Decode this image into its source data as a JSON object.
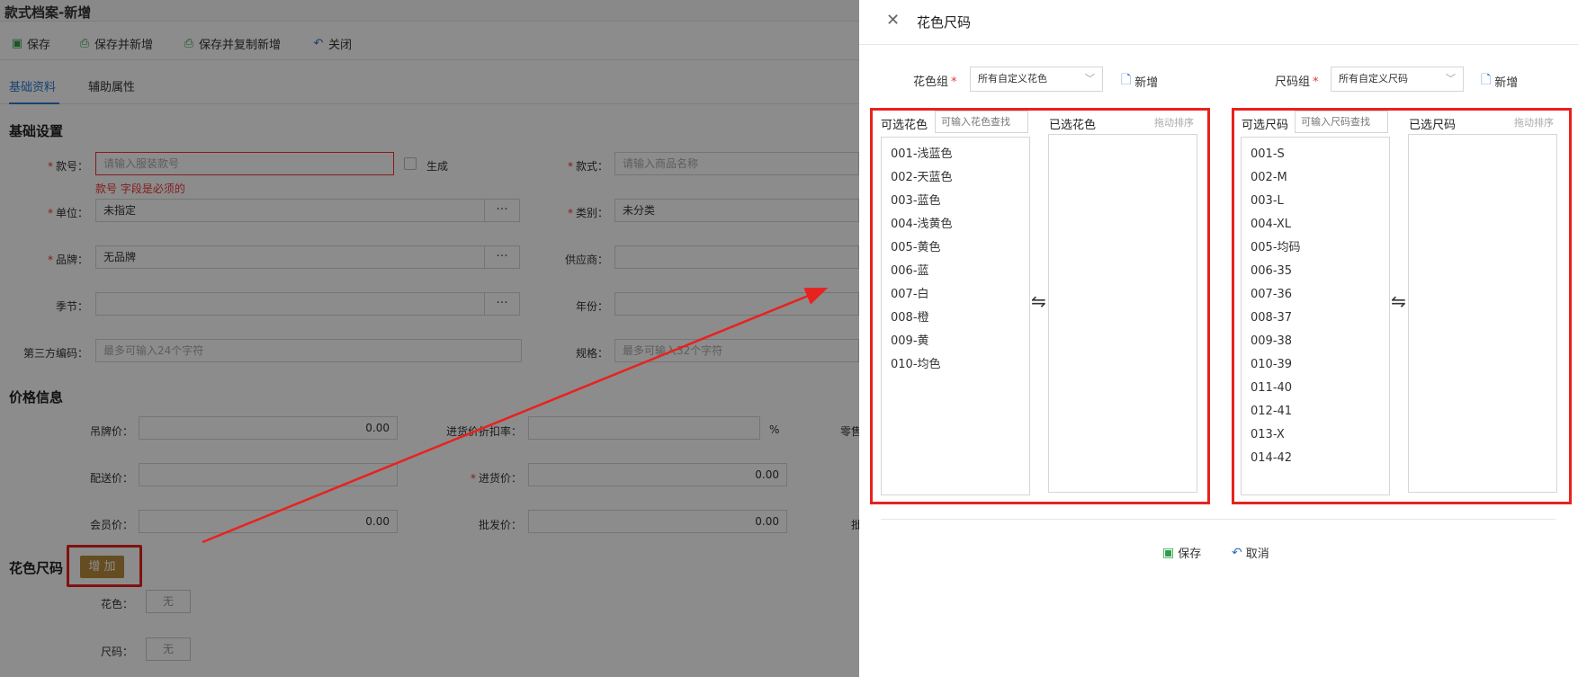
{
  "page": {
    "title": "款式档案-新增",
    "toolbar": {
      "save": "保存",
      "save_new": "保存并新增",
      "save_copy_new": "保存并复制新增",
      "close": "关闭"
    },
    "tabs": [
      "基础资料",
      "辅助属性"
    ],
    "basic_section": "基础设置",
    "fields": {
      "style_no_label": "款号",
      "style_no_placeholder": "请输入服装款号",
      "generate_label": "生成",
      "style_no_error": "款号 字段是必须的",
      "style_label": "款式",
      "style_placeholder": "请输入商品名称",
      "unit_label": "单位",
      "unit_value": "未指定",
      "category_label": "类别",
      "category_value": "未分类",
      "brand_label": "品牌",
      "brand_value": "无品牌",
      "supplier_label": "供应商",
      "season_label": "季节",
      "year_label": "年份",
      "third_code_label": "第三方编码",
      "third_code_placeholder": "最多可输入24个字符",
      "spec_label": "规格",
      "spec_placeholder": "最多可输入32个字符",
      "dots": "···"
    },
    "price_section": "价格信息",
    "price": {
      "tag_price_label": "吊牌价",
      "tag_price_value": "0.00",
      "discount_label": "进货价折扣率",
      "percent": "%",
      "retail_label_partial": "零售",
      "delivery_label": "配送价",
      "purchase_label": "进货价",
      "purchase_value": "0.00",
      "member_label": "会员价",
      "member_value": "0.00",
      "wholesale_label": "批发价",
      "wholesale_value": "0.00",
      "extra_label_partial": "批"
    },
    "color_size_section": "花色尺码",
    "add_button": "增 加",
    "color_label": "花色",
    "size_label": "尺码",
    "none_text": "无"
  },
  "dialog": {
    "title": "花色尺码",
    "color_group_label": "花色组",
    "color_group_value": "所有自定义花色",
    "size_group_label": "尺码组",
    "size_group_value": "所有自定义尺码",
    "new_label": "新增",
    "color_panel": {
      "available_label": "可选花色",
      "search_placeholder": "可输入花色查找",
      "selected_label": "已选花色",
      "drag_hint": "拖动排序",
      "items": [
        "001-浅蓝色",
        "002-天蓝色",
        "003-蓝色",
        "004-浅黄色",
        "005-黄色",
        "006-蓝",
        "007-白",
        "008-橙",
        "009-黄",
        "010-均色"
      ]
    },
    "size_panel": {
      "available_label": "可选尺码",
      "search_placeholder": "可输入尺码查找",
      "selected_label": "已选尺码",
      "drag_hint": "拖动排序",
      "items": [
        "001-S",
        "002-M",
        "003-L",
        "004-XL",
        "005-均码",
        "006-35",
        "007-36",
        "008-37",
        "009-38",
        "010-39",
        "011-40",
        "012-41",
        "013-X",
        "014-42"
      ]
    },
    "swap_symbol": "⇋",
    "save": "保存",
    "cancel": "取消"
  },
  "colors": {
    "annotation_red": "#e8221e",
    "accent_blue": "#2d7ad3",
    "add_button_bg": "#b98b3c",
    "save_icon_green": "#2e9e48"
  }
}
